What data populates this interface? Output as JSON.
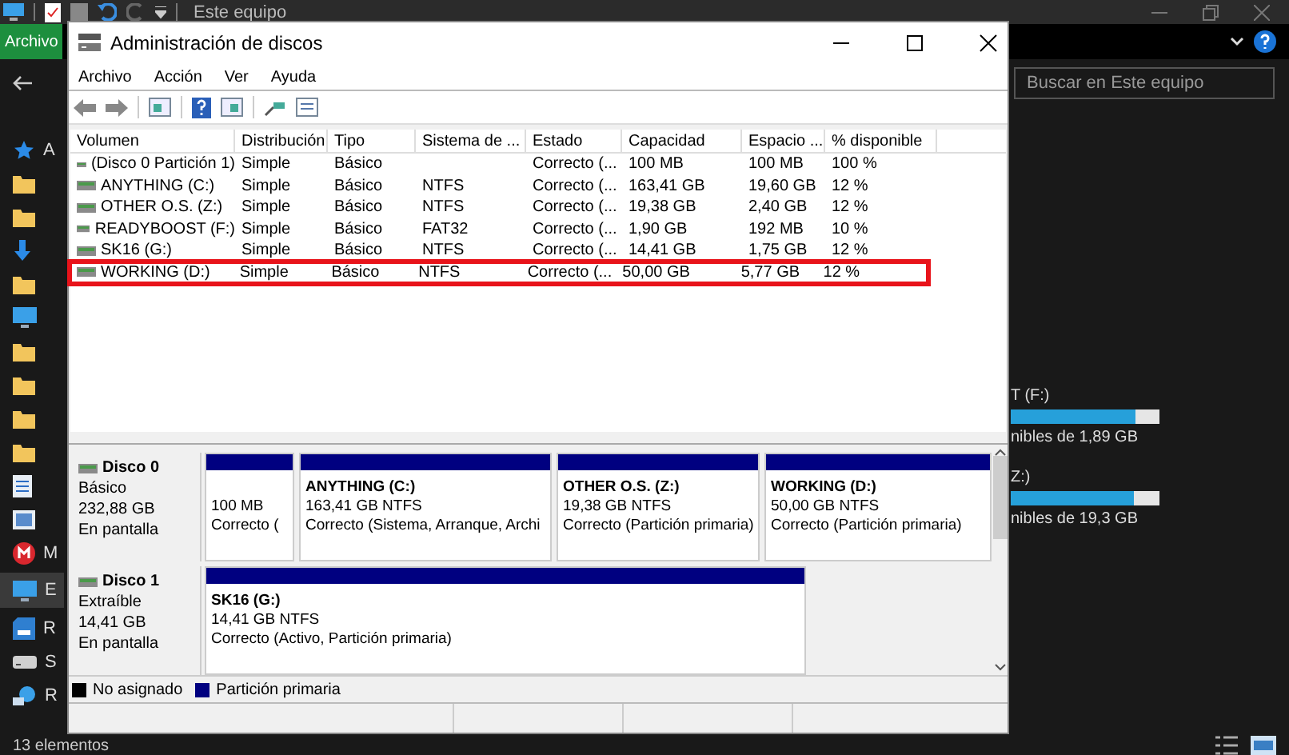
{
  "explorer": {
    "title": "Este equipo",
    "ribbon_tab": "Archivo",
    "search": {
      "placeholder": "Buscar en Este equipo"
    },
    "nav": [
      {
        "kind": "star",
        "label": "A",
        "selected": false
      },
      {
        "kind": "folder",
        "selected": false
      },
      {
        "kind": "folder",
        "selected": false
      },
      {
        "kind": "download",
        "selected": false
      },
      {
        "kind": "folder",
        "selected": false
      },
      {
        "kind": "pc",
        "selected": false
      },
      {
        "kind": "folder",
        "selected": false
      },
      {
        "kind": "folder",
        "selected": false
      },
      {
        "kind": "folder",
        "selected": false
      },
      {
        "kind": "folder",
        "selected": false
      },
      {
        "kind": "doc",
        "selected": false
      },
      {
        "kind": "picture",
        "selected": false
      },
      {
        "kind": "mega",
        "label": "M",
        "selected": false
      },
      {
        "kind": "pc",
        "label": "E",
        "selected": true
      },
      {
        "kind": "sd",
        "label": "R",
        "selected": false
      },
      {
        "kind": "drive",
        "label": "S",
        "selected": false
      },
      {
        "kind": "network",
        "label": "R",
        "selected": false
      }
    ],
    "drives": [
      {
        "name": "T (F:)",
        "level": 0.84,
        "free": "nibles de 1,89 GB"
      },
      {
        "name": "Z:)",
        "level": 0.83,
        "free": "nibles de 19,3 GB"
      }
    ],
    "status": "13 elementos"
  },
  "window": {
    "title": "Administración de discos",
    "menu": [
      "Archivo",
      "Acción",
      "Ver",
      "Ayuda"
    ],
    "table": {
      "columns": [
        "Volumen",
        "Distribución",
        "Tipo",
        "Sistema de ...",
        "Estado",
        "Capacidad",
        "Espacio ...",
        "% disponible"
      ],
      "rows": [
        {
          "cells": [
            "(Disco 0 Partición 1)",
            "Simple",
            "Básico",
            "",
            "Correcto (...",
            "100 MB",
            "100 MB",
            "100 %"
          ],
          "highlighted": false
        },
        {
          "cells": [
            "ANYTHING (C:)",
            "Simple",
            "Básico",
            "NTFS",
            "Correcto (...",
            "163,41 GB",
            "19,60 GB",
            "12 %"
          ],
          "highlighted": false
        },
        {
          "cells": [
            "OTHER O.S. (Z:)",
            "Simple",
            "Básico",
            "NTFS",
            "Correcto (...",
            "19,38 GB",
            "2,40 GB",
            "12 %"
          ],
          "highlighted": false
        },
        {
          "cells": [
            "READYBOOST (F:)",
            "Simple",
            "Básico",
            "FAT32",
            "Correcto (...",
            "1,90 GB",
            "192 MB",
            "10 %"
          ],
          "highlighted": false
        },
        {
          "cells": [
            "SK16 (G:)",
            "Simple",
            "Básico",
            "NTFS",
            "Correcto (...",
            "14,41 GB",
            "1,75 GB",
            "12 %"
          ],
          "highlighted": false
        },
        {
          "cells": [
            "WORKING (D:)",
            "Simple",
            "Básico",
            "NTFS",
            "Correcto (...",
            "50,00 GB",
            "5,77 GB",
            "12 %"
          ],
          "highlighted": true
        }
      ]
    },
    "disks": [
      {
        "name": "Disco 0",
        "type": "Básico",
        "size": "232,88 GB",
        "status": "En pantalla",
        "partitions": [
          {
            "size": "100 MB",
            "status": "Correcto ("
          },
          {
            "title": "ANYTHING  (C:)",
            "size": "163,41 GB NTFS",
            "status": "Correcto (Sistema, Arranque, Archi"
          },
          {
            "title": "OTHER O.S.  (Z:)",
            "size": "19,38 GB NTFS",
            "status": "Correcto (Partición primaria)"
          },
          {
            "title": "WORKING  (D:)",
            "size": "50,00 GB NTFS",
            "status": "Correcto (Partición primaria)"
          }
        ]
      },
      {
        "name": "Disco 1",
        "type": "Extraíble",
        "size": "14,41 GB",
        "status": "En pantalla",
        "partitions": [
          {
            "title": "SK16  (G:)",
            "size": "14,41 GB NTFS",
            "status": "Correcto (Activo, Partición primaria)"
          }
        ]
      }
    ],
    "legend": [
      {
        "label": "No asignado",
        "color": "#000000"
      },
      {
        "label": "Partición primaria",
        "color": "#000080"
      }
    ]
  }
}
